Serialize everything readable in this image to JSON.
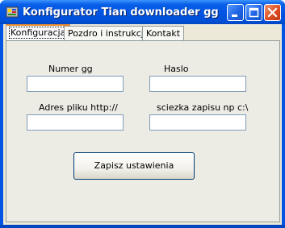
{
  "window": {
    "title": "Konfigurator Tian downloader gg"
  },
  "tabs": [
    "Konfiguracja",
    "Pozdro i instrukcja",
    "Kontakt"
  ],
  "form": {
    "numer_label": "Numer gg",
    "numer_value": "",
    "haslo_label": "Haslo",
    "haslo_value": "",
    "adres_label": "Adres pliku http://",
    "adres_value": "",
    "sciezka_label": "sciezka zapisu np c:\\",
    "sciezka_value": "",
    "save_label": "Zapisz ustawienia"
  },
  "icons": {
    "app": "app-icon",
    "minimize": "minimize-icon",
    "maximize": "maximize-icon",
    "close": "close-icon"
  },
  "colors": {
    "titlebar": "#0054e3",
    "client": "#ece9d8",
    "tab_accent": "#e68b2c"
  }
}
